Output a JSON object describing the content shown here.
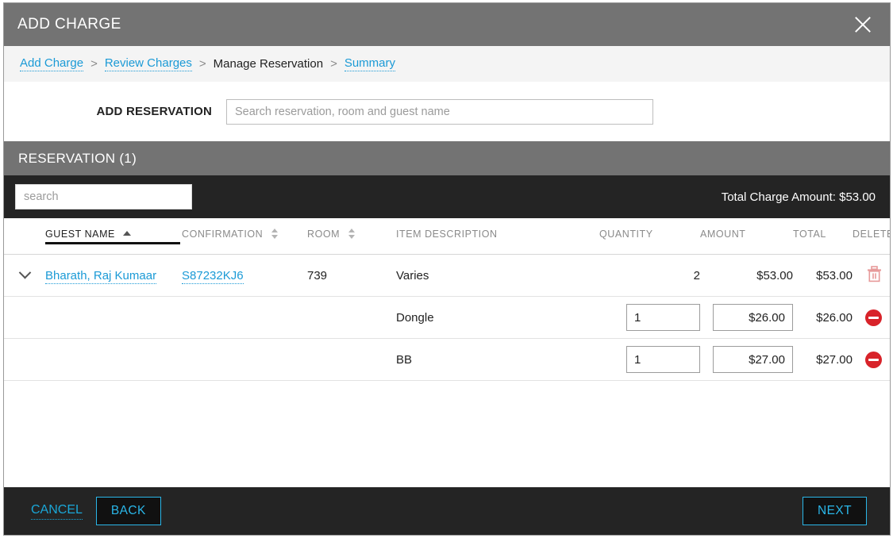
{
  "dialog": {
    "title": "ADD CHARGE",
    "close_icon": "close-icon"
  },
  "breadcrumb": {
    "separator": ">",
    "items": [
      {
        "label": "Add Charge",
        "active": false
      },
      {
        "label": "Review Charges",
        "active": false
      },
      {
        "label": "Manage Reservation",
        "active": true
      },
      {
        "label": "Summary",
        "active": false
      }
    ]
  },
  "add_reservation": {
    "label": "ADD RESERVATION",
    "placeholder": "Search reservation, room and guest name",
    "value": ""
  },
  "reservation_section": {
    "title": "RESERVATION (1)"
  },
  "toolbar": {
    "search_placeholder": "search",
    "search_value": "",
    "total_charge_label": "Total Charge Amount: $53.00"
  },
  "table": {
    "columns": [
      {
        "key": "expand",
        "label": "",
        "sort": "none"
      },
      {
        "key": "guest",
        "label": "GUEST NAME",
        "sort": "asc"
      },
      {
        "key": "confirmation",
        "label": "CONFIRMATION",
        "sort": "both"
      },
      {
        "key": "room",
        "label": "ROOM",
        "sort": "both"
      },
      {
        "key": "item",
        "label": "ITEM DESCRIPTION",
        "sort": "none"
      },
      {
        "key": "quantity",
        "label": "QUANTITY",
        "sort": "none"
      },
      {
        "key": "amount",
        "label": "AMOUNT",
        "sort": "none"
      },
      {
        "key": "total",
        "label": "TOTAL",
        "sort": "none"
      },
      {
        "key": "delete",
        "label": "DELETE",
        "sort": "none"
      }
    ],
    "parent_row": {
      "expand_icon": "chevron-down-icon",
      "guest_name": "Bharath, Raj Kumaar",
      "confirmation": "S87232KJ6",
      "room": "739",
      "item_description": "Varies",
      "quantity": "2",
      "amount": "$53.00",
      "total": "$53.00",
      "delete_icon": "trash-icon"
    },
    "sub_rows": [
      {
        "item_description": "Dongle",
        "quantity": "1",
        "amount": "$26.00",
        "total": "$26.00",
        "delete_icon": "minus-circle-icon"
      },
      {
        "item_description": "BB",
        "quantity": "1",
        "amount": "$27.00",
        "total": "$27.00",
        "delete_icon": "minus-circle-icon"
      }
    ]
  },
  "footer": {
    "cancel_label": "CANCEL",
    "back_label": "BACK",
    "next_label": "NEXT"
  },
  "colors": {
    "header_gray": "#737373",
    "dark_strip": "#242424",
    "link_blue": "#1b9ad6",
    "accent_cyan": "#2ab6e8",
    "danger_red": "#d8232a",
    "trash_pink": "#e79a9a"
  }
}
